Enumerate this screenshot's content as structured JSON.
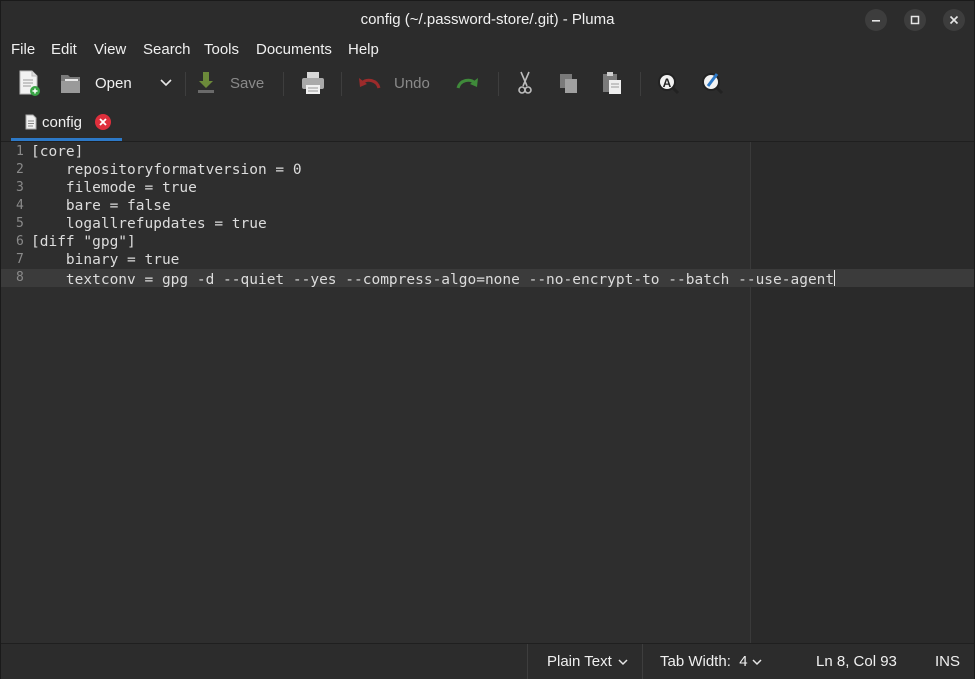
{
  "window": {
    "title": "config (~/.password-store/.git) - Pluma"
  },
  "menu": [
    "File",
    "Edit",
    "View",
    "Search",
    "Tools",
    "Documents",
    "Help"
  ],
  "toolbar": {
    "open_label": "Open",
    "save_label": "Save",
    "undo_label": "Undo"
  },
  "tab": {
    "label": "config"
  },
  "lines": [
    {
      "num": "1",
      "text": "[core]"
    },
    {
      "num": "2",
      "text": "    repositoryformatversion = 0"
    },
    {
      "num": "3",
      "text": "    filemode = true"
    },
    {
      "num": "4",
      "text": "    bare = false"
    },
    {
      "num": "5",
      "text": "    logallrefupdates = true"
    },
    {
      "num": "6",
      "text": "[diff \"gpg\"]"
    },
    {
      "num": "7",
      "text": "    binary = true"
    },
    {
      "num": "8",
      "text": "    textconv = gpg -d --quiet --yes --compress-algo=none --no-encrypt-to --batch --use-agent"
    }
  ],
  "status": {
    "language": "Plain Text",
    "tab_width": "Tab Width:  4",
    "position": "Ln 8, Col 93",
    "mode": "INS"
  },
  "colors": {
    "accent": "#2d79c7",
    "close_red": "#df2f3c"
  }
}
